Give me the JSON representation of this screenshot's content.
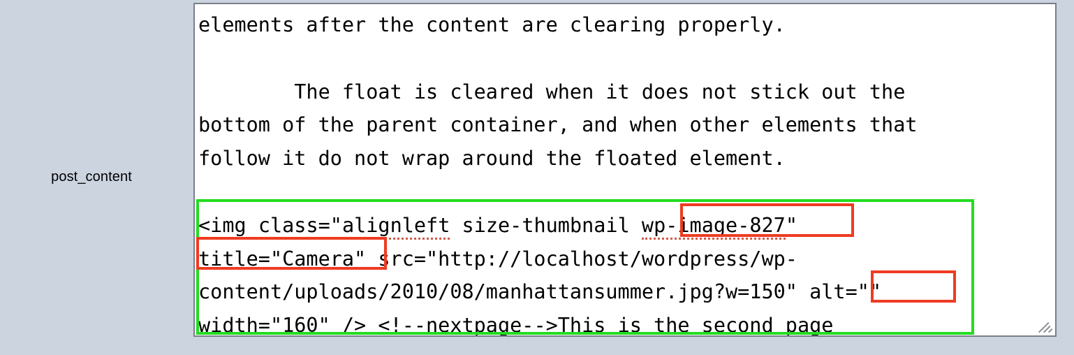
{
  "field": {
    "label": "post_content"
  },
  "editor": {
    "name": "post-content-textarea",
    "lines": [
      {
        "id": "l1",
        "text": "elements after the content are clearing properly."
      },
      {
        "id": "l2",
        "text": ""
      },
      {
        "id": "l3",
        "text": "        The float is cleared when it does not stick out the"
      },
      {
        "id": "l4",
        "text": "bottom of the parent container, and when other elements that"
      },
      {
        "id": "l5",
        "text": "follow it do not wrap around the floated element."
      },
      {
        "id": "l6",
        "text": ""
      }
    ],
    "code_lines": {
      "c1_a": "<",
      "c1_b": "img",
      "c1_c": " class=\"",
      "c1_d": "alignleft",
      "c1_e": " size-thumbnail ",
      "c1_f": "wp-image-827",
      "c1_g": "\"",
      "c2_a": "title=\"Camera\"",
      "c2_b": " src=\"http://localhost/wordpress/wp-",
      "c3_a": "content/uploads/2010/08/manhattansummer.jpg?w=150\" ",
      "c3_b": "alt=\"\"",
      "c4_a": "width=\"160\" /> <!--",
      "c4_b": "nextpage",
      "c4_c": "-->This is the second page"
    }
  },
  "annotations": [
    {
      "id": "box-img-tag",
      "kind": "highlight-region",
      "color": "#22dd22",
      "target": "img-html-tag"
    },
    {
      "id": "box-wp-image",
      "kind": "highlight-token",
      "color": "#ef3b22",
      "target": "wp-image-827"
    },
    {
      "id": "box-title-attr",
      "kind": "highlight-token",
      "color": "#ef3b22",
      "target": "title=\"Camera\""
    },
    {
      "id": "box-alt-attr",
      "kind": "highlight-token",
      "color": "#ef3b22",
      "target": "alt=\"\""
    }
  ],
  "colors": {
    "page_background": "#ccd4e0",
    "textarea_background": "#ffffff",
    "textarea_border": "#7a7f87",
    "text": "#000000",
    "annotation_green": "#22dd22",
    "annotation_red": "#ef3b22",
    "spellcheck_underline": "#d05a4a"
  }
}
